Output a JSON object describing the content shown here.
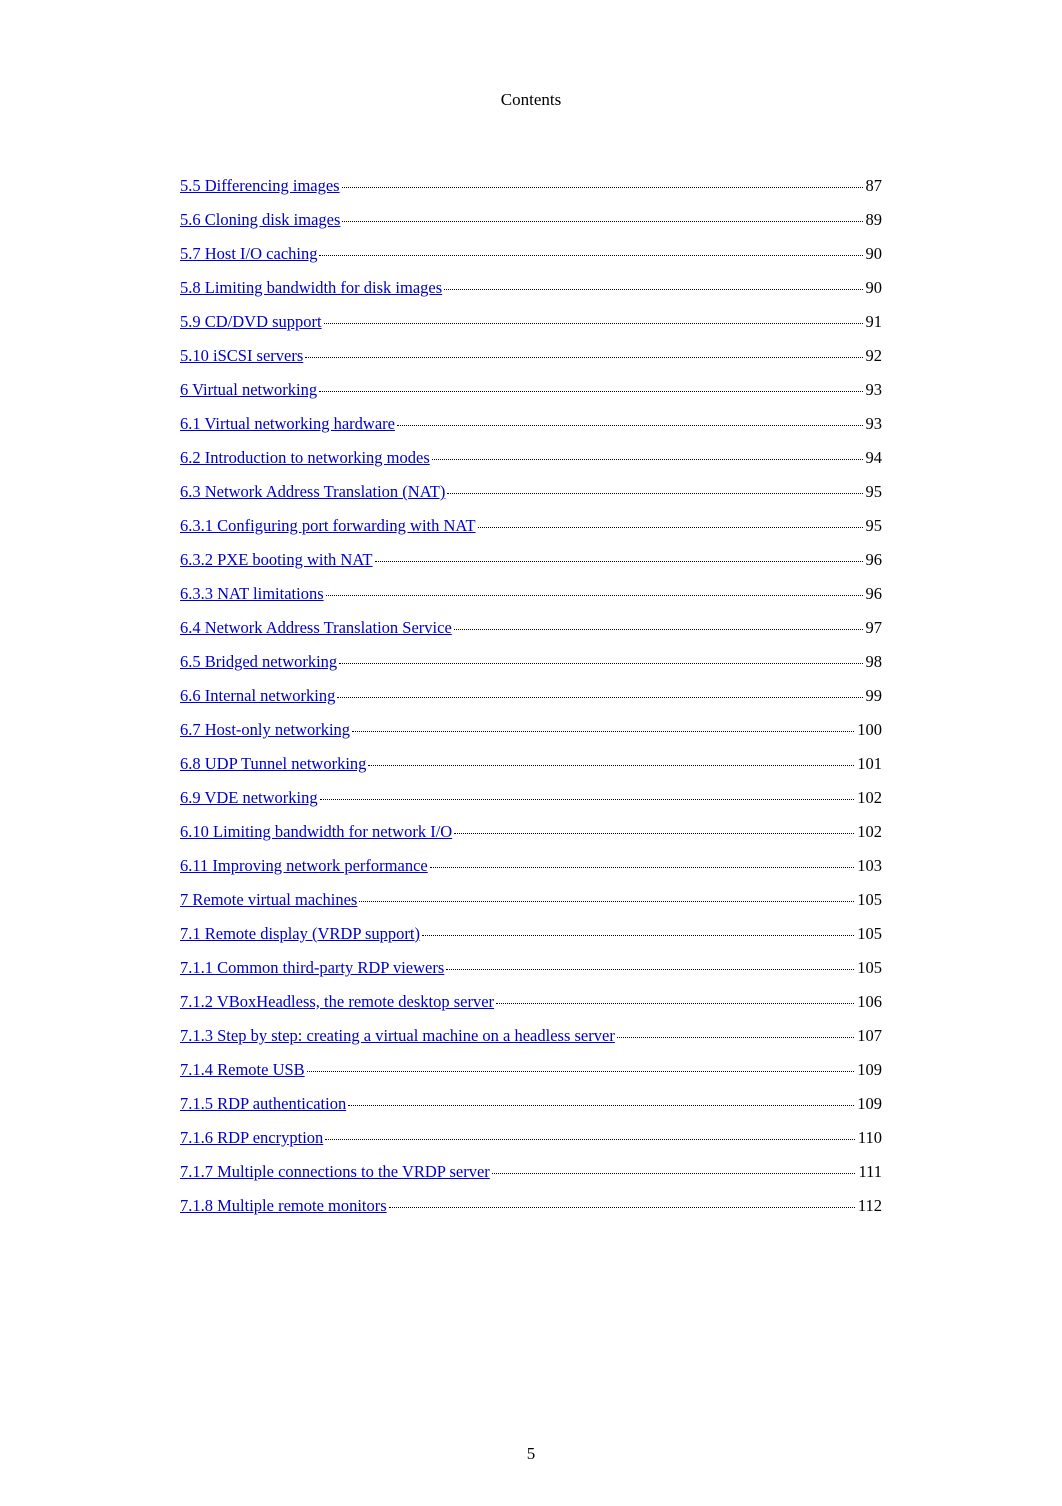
{
  "header": "Contents",
  "page_number": "5",
  "toc_entries": [
    {
      "title": "5.5 Differencing images",
      "page": "87"
    },
    {
      "title": "5.6 Cloning disk images",
      "page": "89"
    },
    {
      "title": "5.7 Host I/O caching",
      "page": "90"
    },
    {
      "title": "5.8 Limiting bandwidth for disk images",
      "page": "90"
    },
    {
      "title": "5.9 CD/DVD support",
      "page": "91"
    },
    {
      "title": "5.10 iSCSI servers",
      "page": "92"
    },
    {
      "title": "6 Virtual networking",
      "page": "93"
    },
    {
      "title": "6.1 Virtual networking hardware",
      "page": "93"
    },
    {
      "title": "6.2 Introduction to networking modes",
      "page": "94"
    },
    {
      "title": "6.3 Network Address Translation (NAT)",
      "page": "95"
    },
    {
      "title": "6.3.1 Configuring port forwarding with NAT",
      "page": "95"
    },
    {
      "title": "6.3.2 PXE booting with NAT",
      "page": "96"
    },
    {
      "title": "6.3.3 NAT limitations",
      "page": "96"
    },
    {
      "title": "6.4 Network Address Translation Service",
      "page": "97"
    },
    {
      "title": "6.5 Bridged networking",
      "page": "98"
    },
    {
      "title": "6.6 Internal networking",
      "page": "99"
    },
    {
      "title": "6.7 Host-only networking",
      "page": "100"
    },
    {
      "title": "6.8 UDP Tunnel networking",
      "page": "101"
    },
    {
      "title": "6.9 VDE networking",
      "page": "102"
    },
    {
      "title": "6.10 Limiting bandwidth for network I/O",
      "page": "102"
    },
    {
      "title": "6.11 Improving network performance",
      "page": "103"
    },
    {
      "title": "7 Remote virtual machines",
      "page": "105"
    },
    {
      "title": "7.1 Remote display (VRDP support)",
      "page": "105"
    },
    {
      "title": "7.1.1 Common third-party RDP viewers",
      "page": "105"
    },
    {
      "title": "7.1.2 VBoxHeadless, the remote desktop server",
      "page": "106"
    },
    {
      "title": "7.1.3 Step by step: creating a virtual machine on a headless server",
      "page": "107"
    },
    {
      "title": "7.1.4 Remote USB",
      "page": "109"
    },
    {
      "title": "7.1.5 RDP authentication",
      "page": "109"
    },
    {
      "title": "7.1.6 RDP encryption",
      "page": "110"
    },
    {
      "title": "7.1.7 Multiple connections to the VRDP server",
      "page": "111"
    },
    {
      "title": "7.1.8 Multiple remote monitors",
      "page": "112"
    }
  ]
}
